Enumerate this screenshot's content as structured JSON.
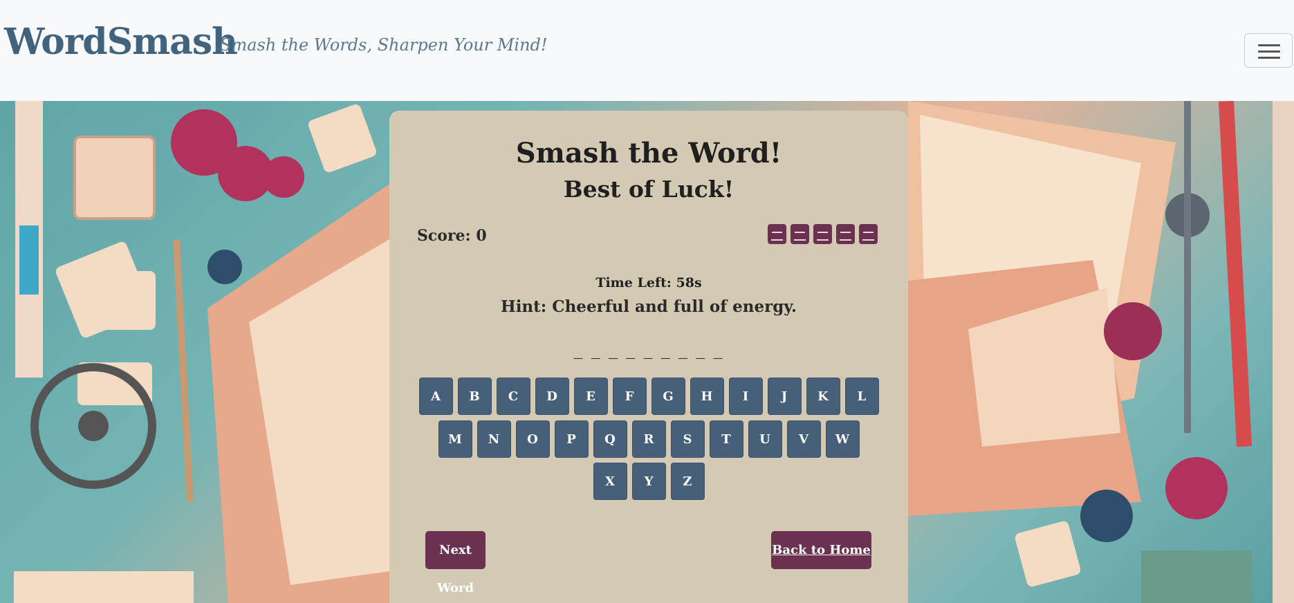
{
  "navbar": {
    "brand": "WordSmash",
    "tagline": "Smash the Words, Sharpen Your Mind!",
    "menu_icon": "hamburger-icon"
  },
  "game": {
    "title": "Smash the Word!",
    "subtitle": "Best of Luck!",
    "score_label": "Score: 0",
    "score": 0,
    "lives_count": 5,
    "lives_icon": "life-icon",
    "time_left": "Time Left: 58s",
    "hint": "Hint: Cheerful and full of energy.",
    "word_blanks": "_ _ _ _ _ _ _ _ _",
    "keyboard_rows": [
      [
        "A",
        "B",
        "C",
        "D",
        "E",
        "F",
        "G",
        "H",
        "I",
        "J",
        "K",
        "L"
      ],
      [
        "M",
        "N",
        "O",
        "P",
        "Q",
        "R",
        "S",
        "T",
        "U",
        "V",
        "W"
      ],
      [
        "X",
        "Y",
        "Z"
      ]
    ],
    "next_button": "Next Word",
    "home_button": "Back to Home"
  },
  "colors": {
    "brand": "#42637d",
    "card": "#d4cab4",
    "key": "#466079",
    "accent": "#6a3150"
  }
}
